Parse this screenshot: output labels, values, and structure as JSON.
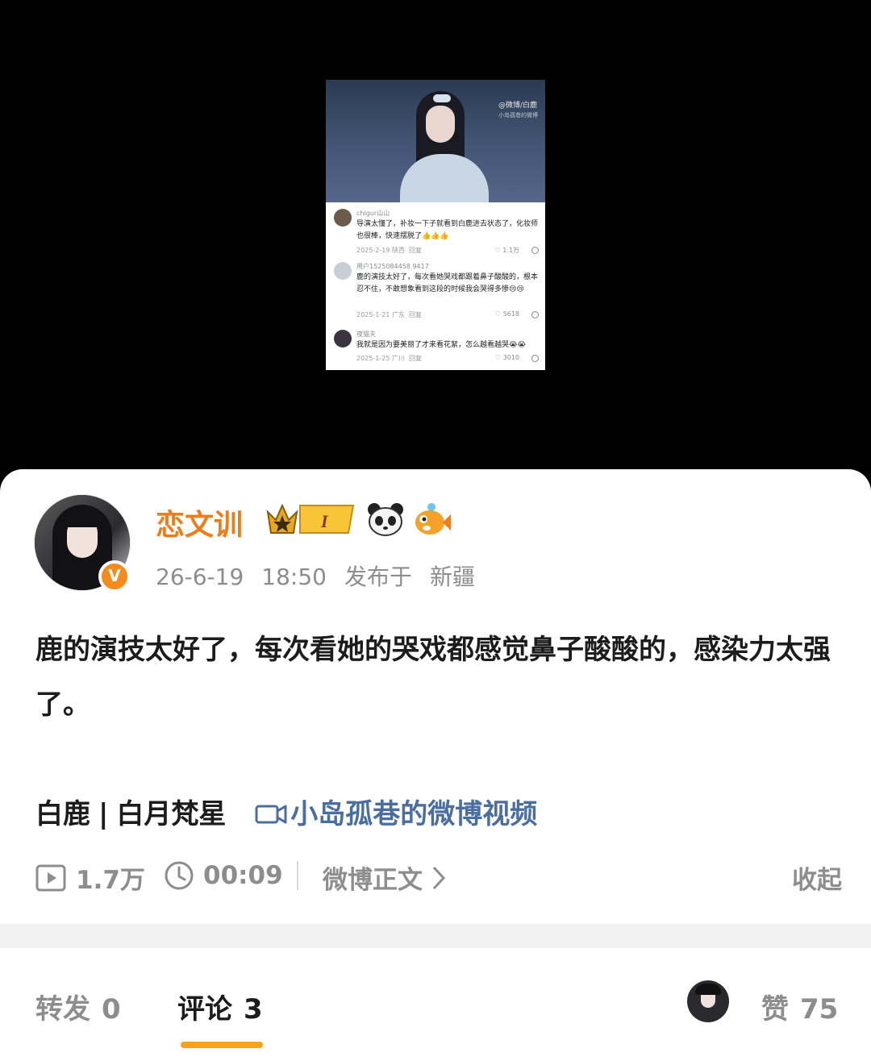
{
  "thumbnail": {
    "watermark_line1": "@微博/白鹿",
    "watermark_line2": "小岛孤巷的微博",
    "comments": [
      {
        "name": "chigur山山",
        "text": "导演太懂了，补妆一下子就看到白鹿进去状态了，化妆师也很棒，快速摆脱了👍👍👍",
        "date": "2025-2-19",
        "location": "陕西",
        "reply": "回复",
        "likes": "1.1万"
      },
      {
        "name": "用户1525084458 9417",
        "text": "鹿的演技太好了，每次看她哭戏都跟着鼻子酸酸的，根本忍不住，不敢想象看到这段的时候我会哭得多惨😢😢",
        "date": "2025-1-21",
        "location": "广东",
        "reply": "回复",
        "likes": "5618"
      },
      {
        "name": "夜猫夫",
        "text": "我就是因为要美丽了才来看花絮，怎么越看越哭😭😭",
        "date": "2025-1-25",
        "location": "广川",
        "reply": "回复",
        "likes": "3010"
      }
    ]
  },
  "post": {
    "username": "恋文训",
    "badge_level": "I",
    "verified_mark": "V",
    "date": "26-6-19",
    "time": "18:50",
    "published_label": "发布于",
    "location": "新疆",
    "text": "鹿的演技太好了，每次看她的哭戏都感觉鼻子酸酸的，感染力太强了。",
    "topic_left": "白鹿",
    "topic_sep": "|",
    "topic_right": "白月梵星",
    "video_link": "小岛孤巷的微博视频",
    "views": "1.7万",
    "duration": "00:09",
    "weibo_text_link": "微博正文",
    "collapse": "收起"
  },
  "tabs": {
    "repost_label": "转发",
    "repost_count": "0",
    "comment_label": "评论",
    "comment_count": "3",
    "like_label": "赞",
    "like_count": "75"
  },
  "colors": {
    "username": "#f07c19",
    "link": "#4a6ea0",
    "tab_underline": "#f7a21b",
    "muted": "#8d8d8d"
  }
}
